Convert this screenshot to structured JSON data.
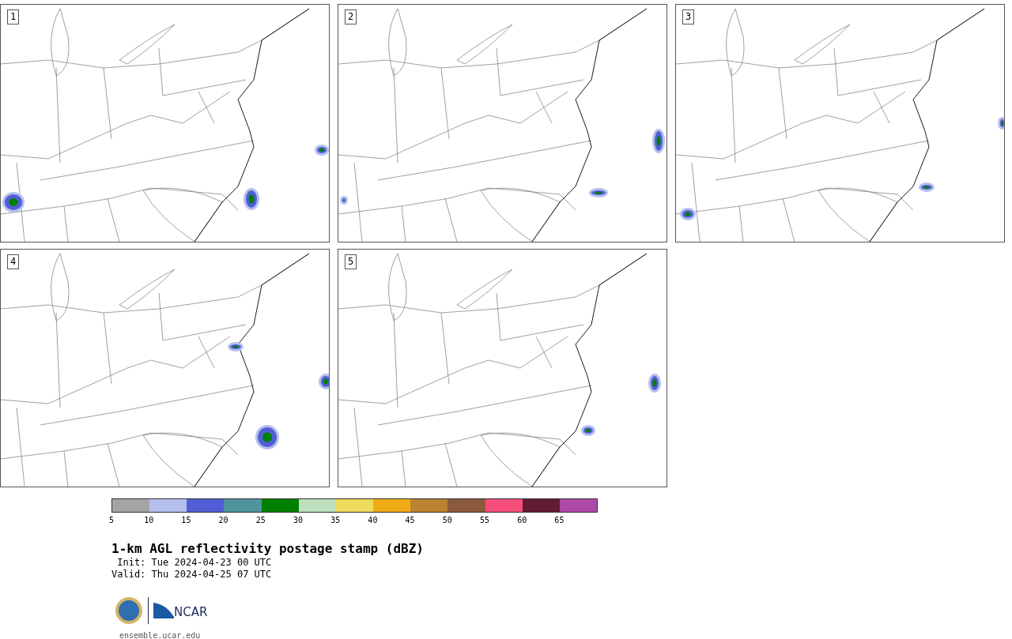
{
  "panels": [
    {
      "label": "1"
    },
    {
      "label": "2"
    },
    {
      "label": "3"
    },
    {
      "label": "4"
    },
    {
      "label": "5"
    }
  ],
  "colorbar": {
    "bins": [
      {
        "color": "#a5a5a5"
      },
      {
        "color": "#b5bfee"
      },
      {
        "color": "#525ed6"
      },
      {
        "color": "#4f949c"
      },
      {
        "color": "#008000"
      },
      {
        "color": "#bedfbe"
      },
      {
        "color": "#efdb5c"
      },
      {
        "color": "#f0ac16"
      },
      {
        "color": "#bb8231"
      },
      {
        "color": "#8b593e"
      },
      {
        "color": "#f64e7b"
      },
      {
        "color": "#621b35"
      },
      {
        "color": "#ad4aa8"
      }
    ],
    "ticks": [
      "5",
      "10",
      "15",
      "20",
      "25",
      "30",
      "35",
      "40",
      "45",
      "50",
      "55",
      "60",
      "65"
    ]
  },
  "title": "1-km AGL reflectivity postage stamp (dBZ)",
  "init": " Init: Tue 2024-04-23 00 UTC",
  "valid": "Valid: Thu 2024-04-25 07 UTC",
  "logo": {
    "text": "NCAR"
  },
  "footer": "ensemble.ucar.edu"
}
